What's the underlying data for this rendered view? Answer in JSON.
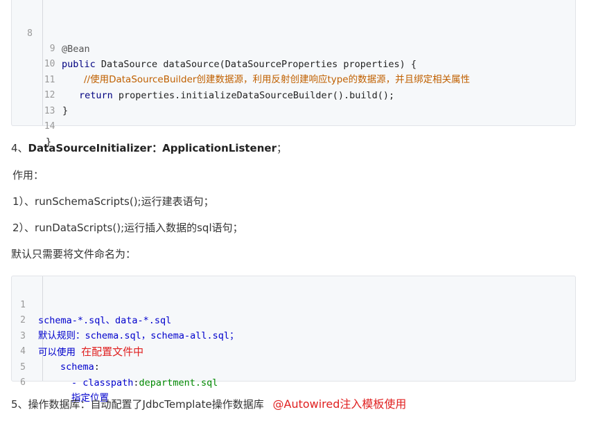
{
  "code_top": {
    "lines": [
      {
        "n": "8",
        "annotation": "@Bean"
      },
      {
        "n": "9",
        "kw": "public",
        "text": " DataSource dataSource(DataSourceProperties properties) {"
      },
      {
        "n": "10",
        "comment": "//使用DataSourceBuilder创建数据源，利用反射创建响应type的数据源，并且绑定相关属性"
      },
      {
        "n": "11",
        "kw": "return",
        "text": " properties.initializeDataSourceBuilder().build();"
      },
      {
        "n": "12",
        "text": "}"
      },
      {
        "n": "13",
        "text": ""
      },
      {
        "n": "14",
        "text": "}"
      }
    ]
  },
  "heading4": {
    "prefix": "4、",
    "bold": "DataSourceInitializer：ApplicationListener",
    "suffix": "；"
  },
  "role_label": "作用：",
  "item1": "1）、runSchemaScripts();运行建表语句；",
  "item2": "2）、runDataScripts();运行插入数据的sql语句；",
  "default_naming": "默认只需要将文件命名为：",
  "code_bottom": {
    "lines": [
      {
        "n": "1",
        "text": "schema-*.sql、data-*.sql"
      },
      {
        "n": "2",
        "text": "默认规则：schema.sql，schema-all.sql；"
      },
      {
        "n": "3",
        "text": "可以使用",
        "note": "在配置文件中"
      },
      {
        "n": "4",
        "key": "schema",
        "sep": ":"
      },
      {
        "n": "5",
        "dash": "- classpath",
        "sep": ":",
        "value": "department.sql"
      },
      {
        "n": "6",
        "text": "指定位置"
      }
    ]
  },
  "heading5": "5、操作数据库：自动配置了JdbcTemplate操作数据库",
  "heading5_note": "@Autowired注入模板使用"
}
